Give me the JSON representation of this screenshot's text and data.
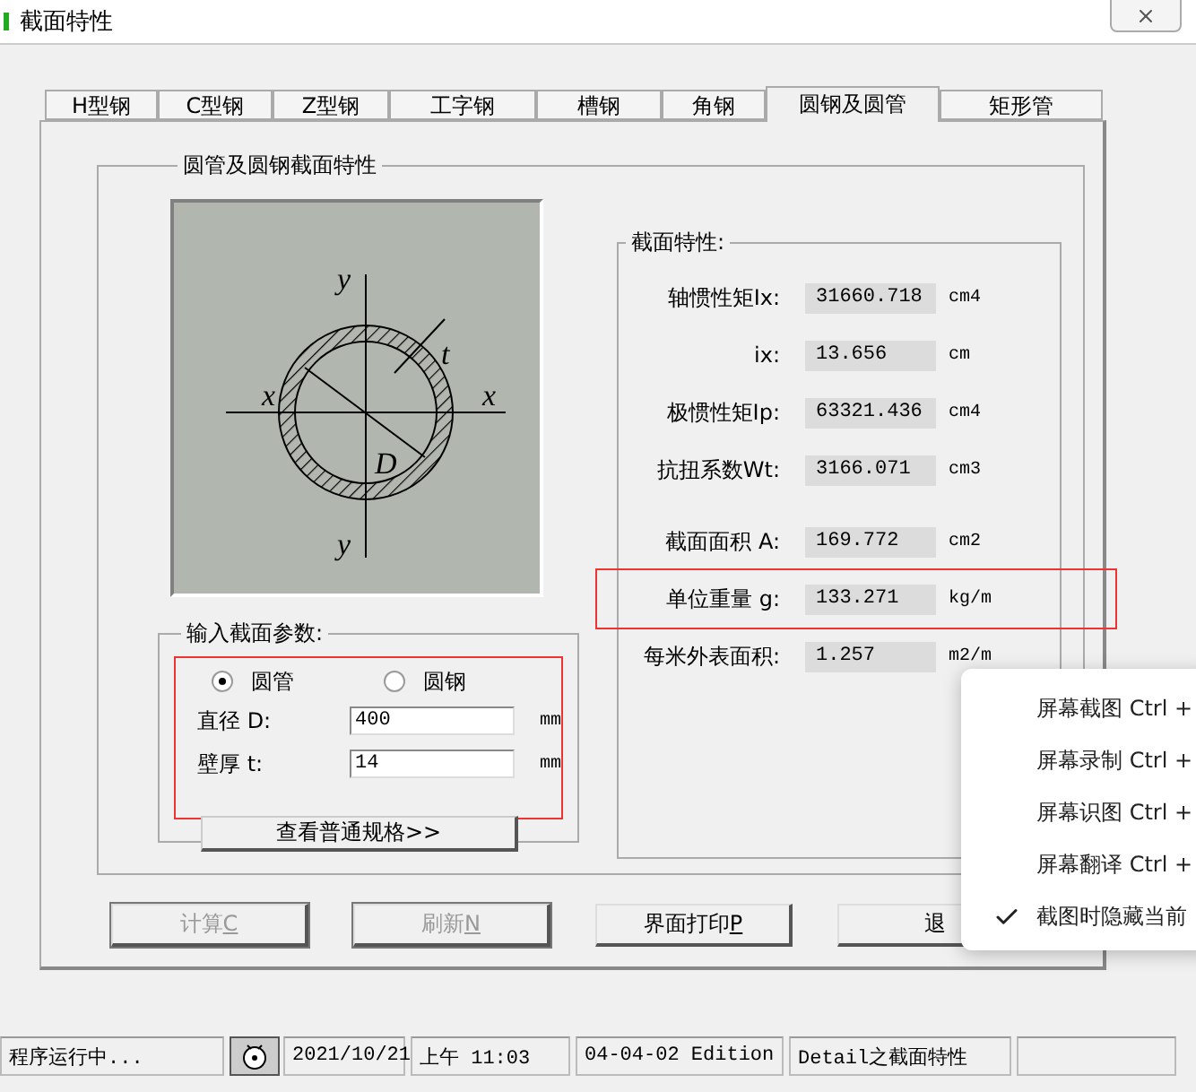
{
  "window": {
    "title": "截面特性"
  },
  "tabs": [
    {
      "label": "H型钢",
      "selected": false
    },
    {
      "label": "C型钢",
      "selected": false
    },
    {
      "label": "Z型钢",
      "selected": false
    },
    {
      "label": "工字钢",
      "selected": false
    },
    {
      "label": "槽钢",
      "selected": false
    },
    {
      "label": "角钢",
      "selected": false
    },
    {
      "label": "圆钢及圆管",
      "selected": true
    },
    {
      "label": "矩形管",
      "selected": false
    }
  ],
  "group": {
    "title": "圆管及圆钢截面特性",
    "diagram": {
      "labels": {
        "y_top": "y",
        "y_bottom": "y",
        "x_left": "x",
        "x_right": "x",
        "diameter": "D",
        "thickness": "t"
      }
    },
    "input": {
      "title": "输入截面参数:",
      "highlighted": true,
      "radios": [
        {
          "label": "圆管",
          "selected": true
        },
        {
          "label": "圆钢",
          "selected": false
        }
      ],
      "fields": [
        {
          "label": "直径 D:",
          "value": "400",
          "unit": "mm"
        },
        {
          "label": "壁厚 t:",
          "value": "14",
          "unit": "mm"
        }
      ],
      "button": "查看普通规格>>"
    },
    "properties": {
      "title": "截面特性:",
      "sections": [
        [
          {
            "kind": "plain",
            "label": "轴惯性矩Ix:",
            "value": "31660.718",
            "unit": "cm4"
          },
          {
            "kind": "plain",
            "label": "ix:",
            "value": "13.656",
            "unit": "cm"
          },
          {
            "kind": "plain",
            "label": "极惯性矩Ip:",
            "value": "63321.436",
            "unit": "cm4"
          },
          {
            "kind": "plain",
            "label": "抗扭系数Wt:",
            "value": "3166.071",
            "unit": "cm3"
          }
        ],
        [
          {
            "kind": "plain",
            "label": "截面面积 A:",
            "value": "169.772",
            "unit": "cm2"
          },
          {
            "kind": "framed",
            "label": "单位重量 g:",
            "value": "133.271",
            "unit": "kg/m"
          },
          {
            "kind": "plain",
            "label": "每米外表面积:",
            "value": "1.257",
            "unit": "m2/m"
          }
        ]
      ]
    }
  },
  "buttons": [
    {
      "label": "计算",
      "key": "C",
      "disabled": true
    },
    {
      "label": "刷新",
      "key": "N",
      "disabled": true
    },
    {
      "label": "界面打印",
      "key": "P",
      "disabled": false
    },
    {
      "label": "退",
      "disabled": false
    }
  ],
  "context_menu": [
    {
      "label": "屏幕截图 Ctrl +",
      "checked": false
    },
    {
      "label": "屏幕录制 Ctrl +",
      "checked": false
    },
    {
      "label": "屏幕识图 Ctrl +",
      "checked": false
    },
    {
      "label": "屏幕翻译 Ctrl +",
      "checked": false
    },
    {
      "label": "截图时隐藏当前",
      "checked": true
    }
  ],
  "status_bar": {
    "message": "程序运行中...",
    "date": "2021/10/21",
    "time": "上午 11:03",
    "edition": "04-04-02 Edition",
    "module": "Detail之截面特性"
  }
}
